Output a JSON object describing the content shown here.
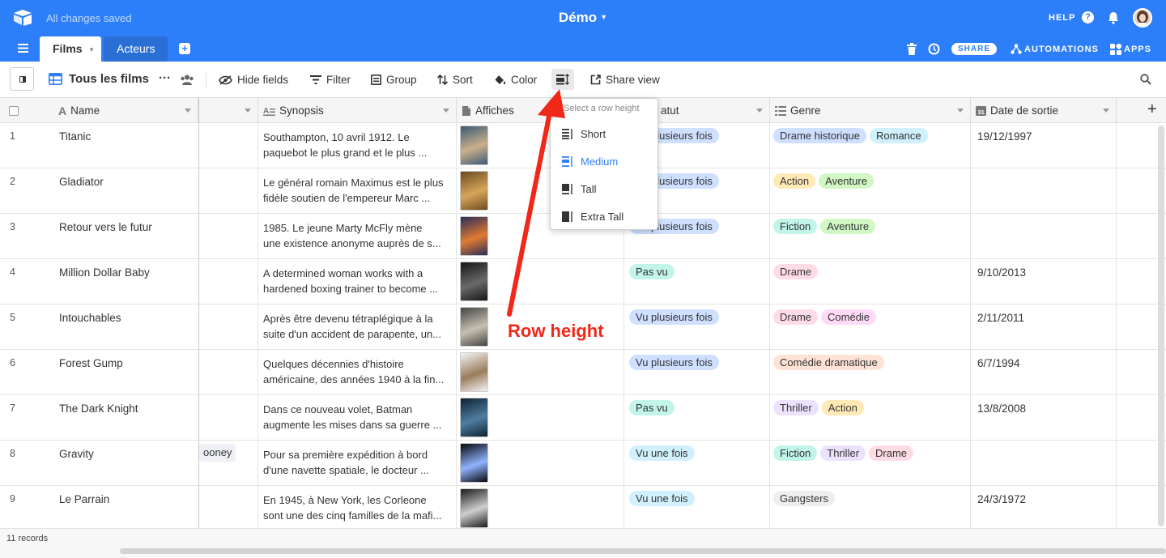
{
  "top": {
    "saved": "All changes saved",
    "base_name": "Démo",
    "help": "HELP",
    "share": "SHARE",
    "automations": "AUTOMATIONS",
    "apps": "APPS"
  },
  "tabs": [
    {
      "label": "Films",
      "active": true
    },
    {
      "label": "Acteurs",
      "active": false
    }
  ],
  "view": {
    "name": "Tous les films",
    "hide_fields": "Hide fields",
    "filter": "Filter",
    "group": "Group",
    "sort": "Sort",
    "color": "Color",
    "share_view": "Share view"
  },
  "columns": {
    "name": "Name",
    "synopsis": "Synopsis",
    "affiches": "Affiches",
    "statut": "atut",
    "genre": "Genre",
    "date": "Date de sortie"
  },
  "rows": [
    {
      "num": "1",
      "name": "Titanic",
      "syn1": "Southampton, 10 avril 1912. Le",
      "syn2": "paquebot le plus grand et le plus ...",
      "status": "Vu plusieurs fois",
      "status_color": "#cfdfff",
      "genres": [
        {
          "t": "Drame historique",
          "c": "#cfdfff"
        },
        {
          "t": "Romance",
          "c": "#d0f0fd"
        }
      ],
      "date": "19/12/1997"
    },
    {
      "num": "2",
      "name": "Gladiator",
      "syn1": "Le général romain Maximus est le plus",
      "syn2": "fidèle soutien de l'empereur Marc ...",
      "status": "Vu plusieurs fois",
      "status_color": "#cfdfff",
      "genres": [
        {
          "t": "Action",
          "c": "#ffeab6"
        },
        {
          "t": "Aventure",
          "c": "#d1f7c4"
        }
      ],
      "date": ""
    },
    {
      "num": "3",
      "name": "Retour vers le futur",
      "syn1": " 1985. Le jeune Marty McFly mène",
      "syn2": "une existence anonyme auprès de s...",
      "status": "Vu plusieurs fois",
      "status_color": "#cfdfff",
      "genres": [
        {
          "t": "Fiction",
          "c": "#c2f5e9"
        },
        {
          "t": "Aventure",
          "c": "#d1f7c4"
        }
      ],
      "date": ""
    },
    {
      "num": "4",
      "name": "Million Dollar Baby",
      "syn1": "A determined woman works with a",
      "syn2": "hardened boxing trainer to become ...",
      "status": "Pas vu",
      "status_color": "#c2f5e9",
      "genres": [
        {
          "t": "Drame",
          "c": "#ffdce5"
        }
      ],
      "date": "9/10/2013"
    },
    {
      "num": "5",
      "name": "Intouchables",
      "syn1": "Après être devenu tétraplégique à la",
      "syn2": "suite d'un accident de parapente, un...",
      "status": "Vu plusieurs fois",
      "status_color": "#cfdfff",
      "genres": [
        {
          "t": "Drame",
          "c": "#ffdce5"
        },
        {
          "t": "Comédie",
          "c": "#ffdaf6"
        }
      ],
      "date": "2/11/2011"
    },
    {
      "num": "6",
      "name": "Forest Gump",
      "syn1": "Quelques décennies d'histoire",
      "syn2": "américaine, des années 1940 à la fin...",
      "status": "Vu plusieurs fois",
      "status_color": "#cfdfff",
      "genres": [
        {
          "t": "Comédie dramatique",
          "c": "#fee2d5"
        }
      ],
      "date": "6/7/1994"
    },
    {
      "num": "7",
      "name": "The Dark Knight",
      "syn1": "Dans ce nouveau volet, Batman",
      "syn2": "augmente les mises dans sa guerre ...",
      "status": "Pas vu",
      "status_color": "#c2f5e9",
      "genres": [
        {
          "t": "Thriller",
          "c": "#ede2fe"
        },
        {
          "t": "Action",
          "c": "#ffeab6"
        }
      ],
      "date": "13/8/2008"
    },
    {
      "num": "8",
      "name": "Gravity",
      "syn1": "Pour sa première expédition à bord",
      "syn2": "d'une navette spatiale, le docteur ...",
      "status": "Vu une fois",
      "status_color": "#d0f0fd",
      "genres": [
        {
          "t": "Fiction",
          "c": "#c2f5e9"
        },
        {
          "t": "Thriller",
          "c": "#ede2fe"
        },
        {
          "t": "Drame",
          "c": "#ffdce5"
        }
      ],
      "date": ""
    },
    {
      "num": "9",
      "name": "Le Parrain",
      "syn1": "En 1945, à New York, les Corleone",
      "syn2": "sont une des cinq familles de la mafi...",
      "status": "Vu une fois",
      "status_color": "#d0f0fd",
      "genres": [
        {
          "t": "Gangsters",
          "c": "#eeeeee"
        }
      ],
      "date": "24/3/1972"
    }
  ],
  "partial_cell": "ooney",
  "menu": {
    "title": "Select a row height",
    "items": [
      {
        "label": "Short",
        "selected": false
      },
      {
        "label": "Medium",
        "selected": true
      },
      {
        "label": "Tall",
        "selected": false
      },
      {
        "label": "Extra Tall",
        "selected": false
      }
    ]
  },
  "annotation": "Row height",
  "footer": {
    "records": "11 records"
  },
  "colors": {
    "brand": "#2d7ff9",
    "annotation": "#f0281a"
  }
}
